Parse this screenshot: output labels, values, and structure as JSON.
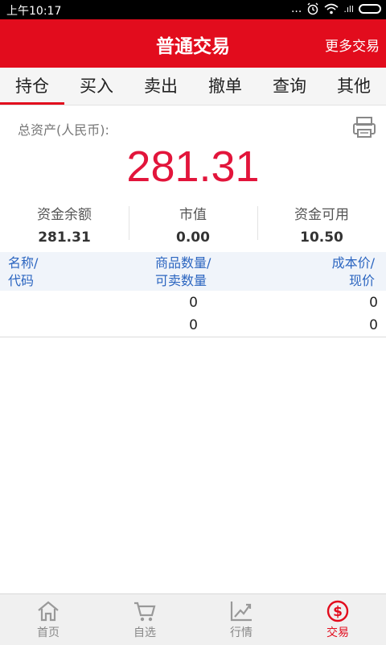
{
  "status_bar": {
    "time": "上午10:17",
    "dots": "...",
    "signal": ".ıll"
  },
  "header": {
    "title": "普通交易",
    "more": "更多交易"
  },
  "tabs": [
    {
      "label": "持仓",
      "active": true
    },
    {
      "label": "买入"
    },
    {
      "label": "卖出"
    },
    {
      "label": "撤单"
    },
    {
      "label": "查询"
    },
    {
      "label": "其他"
    }
  ],
  "assets": {
    "label": "总资产(人民币):",
    "total": "281.31",
    "print_icon": "print-receipt-icon"
  },
  "stats": [
    {
      "label": "资金余额",
      "value": "281.31"
    },
    {
      "label": "市值",
      "value": "0.00"
    },
    {
      "label": "资金可用",
      "value": "10.50"
    }
  ],
  "holdings": {
    "headers": {
      "name_line1": "名称/",
      "name_line2": "代码",
      "qty_line1": "商品数量/",
      "qty_line2": "可卖数量",
      "cost_line1": "成本价/",
      "cost_line2": "现价"
    },
    "row": {
      "qty": "0",
      "sellable": "0",
      "cost": "0",
      "price": "0"
    }
  },
  "bottom_nav": [
    {
      "label": "首页",
      "icon": "home-icon"
    },
    {
      "label": "自选",
      "icon": "cart-icon"
    },
    {
      "label": "行情",
      "icon": "chart-icon"
    },
    {
      "label": "交易",
      "icon": "dollar-icon",
      "active": true
    }
  ],
  "colors": {
    "brand": "#e20c1d",
    "asset_value": "#e2153b",
    "header_text": "#2b65c0"
  }
}
